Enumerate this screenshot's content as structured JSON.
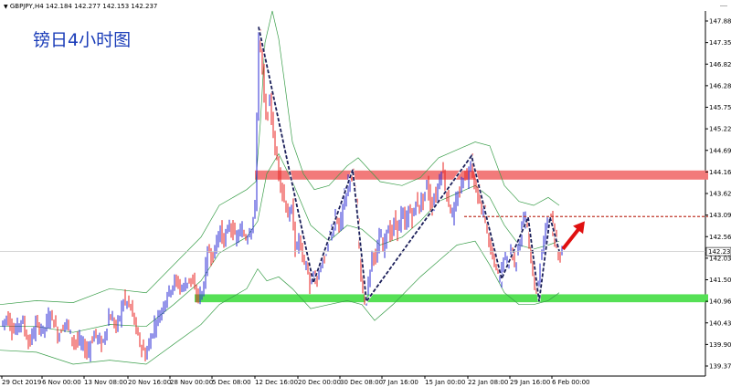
{
  "header": {
    "dropdown_icon": "triangle-down-icon",
    "symbol_timeframe": "GBPJPY,H4",
    "ohlc": "142.184 142.277 142.153 142.237"
  },
  "annotation": {
    "title": "镑日4小时图"
  },
  "colors": {
    "candle_up": "#2b2bd6",
    "candle_down": "#e8211f",
    "bollinger": "#3a9e4a",
    "resistance_zone": "#f27a7a",
    "support_zone": "#55e055",
    "trend_line": "#1b1f5a",
    "arrow": "#e01010",
    "dashed_level": "#c0392b"
  },
  "chart_data": {
    "type": "candlestick",
    "symbol": "GBPJPY",
    "timeframe": "H4",
    "current_price": 142.237,
    "current_price_label": "142.237",
    "ylim": [
      139.1,
      148.3
    ],
    "y_ticks": [
      "147.880",
      "147.350",
      "146.820",
      "146.285",
      "145.755",
      "145.220",
      "144.690",
      "144.160",
      "143.625",
      "143.095",
      "142.560",
      "142.030",
      "141.500",
      "140.965",
      "140.435",
      "139.905",
      "139.370"
    ],
    "x_ticks": [
      "29 Oct 2019",
      "6 Nov 00:00",
      "13 Nov 08:00",
      "20 Nov 16:00",
      "28 Nov 00:00",
      "5 Dec 08:00",
      "12 Dec 16:00",
      "20 Dec 00:00",
      "30 Dec 08:00",
      "7 Jan 16:00",
      "15 Jan 00:00",
      "22 Jan 08:00",
      "29 Jan 16:00",
      "6 Feb 00:00"
    ],
    "price_path": [
      [
        0,
        140.35
      ],
      [
        8,
        140.6
      ],
      [
        16,
        140.2
      ],
      [
        24,
        140.55
      ],
      [
        32,
        139.9
      ],
      [
        40,
        140.4
      ],
      [
        48,
        140.25
      ],
      [
        56,
        140.7
      ],
      [
        64,
        140.1
      ],
      [
        72,
        140.5
      ],
      [
        80,
        140.0
      ],
      [
        88,
        139.95
      ],
      [
        96,
        139.7
      ],
      [
        104,
        140.2
      ],
      [
        112,
        139.85
      ],
      [
        120,
        140.65
      ],
      [
        128,
        140.3
      ],
      [
        136,
        141.05
      ],
      [
        144,
        140.8
      ],
      [
        152,
        140.0
      ],
      [
        160,
        139.6
      ],
      [
        168,
        140.3
      ],
      [
        176,
        140.7
      ],
      [
        184,
        141.2
      ],
      [
        192,
        141.5
      ],
      [
        200,
        141.3
      ],
      [
        208,
        141.6
      ],
      [
        216,
        141.1
      ],
      [
        222,
        141.2
      ],
      [
        228,
        142.3
      ],
      [
        234,
        142.1
      ],
      [
        240,
        142.8
      ],
      [
        246,
        142.5
      ],
      [
        252,
        142.95
      ],
      [
        258,
        142.55
      ],
      [
        264,
        142.75
      ],
      [
        270,
        142.6
      ],
      [
        276,
        142.9
      ],
      [
        280,
        143.4
      ],
      [
        283,
        147.85
      ],
      [
        286,
        147.3
      ],
      [
        289,
        146.2
      ],
      [
        292,
        145.5
      ],
      [
        295,
        146.1
      ],
      [
        298,
        145.6
      ],
      [
        301,
        144.8
      ],
      [
        304,
        144.5
      ],
      [
        308,
        143.9
      ],
      [
        312,
        143.5
      ],
      [
        316,
        143.1
      ],
      [
        320,
        143.3
      ],
      [
        324,
        142.2
      ],
      [
        328,
        142.6
      ],
      [
        332,
        142.0
      ],
      [
        336,
        141.9
      ],
      [
        340,
        141.3
      ],
      [
        344,
        141.6
      ],
      [
        348,
        141.5
      ],
      [
        352,
        142.1
      ],
      [
        356,
        142.0
      ],
      [
        360,
        142.6
      ],
      [
        364,
        142.8
      ],
      [
        368,
        143.2
      ],
      [
        372,
        142.8
      ],
      [
        376,
        143.4
      ],
      [
        380,
        143.7
      ],
      [
        384,
        144.3
      ],
      [
        388,
        143.8
      ],
      [
        392,
        142.9
      ],
      [
        396,
        141.4
      ],
      [
        400,
        141.05
      ],
      [
        404,
        141.5
      ],
      [
        408,
        142.3
      ],
      [
        412,
        142.0
      ],
      [
        416,
        142.7
      ],
      [
        420,
        142.3
      ],
      [
        424,
        142.9
      ],
      [
        428,
        142.6
      ],
      [
        432,
        143.0
      ],
      [
        436,
        142.8
      ],
      [
        440,
        143.2
      ],
      [
        444,
        142.9
      ],
      [
        448,
        143.3
      ],
      [
        452,
        143.1
      ],
      [
        456,
        143.5
      ],
      [
        460,
        143.4
      ],
      [
        464,
        143.6
      ],
      [
        468,
        144.0
      ],
      [
        472,
        143.3
      ],
      [
        476,
        143.6
      ],
      [
        480,
        143.9
      ],
      [
        484,
        144.4
      ],
      [
        488,
        143.8
      ],
      [
        492,
        143.4
      ],
      [
        496,
        143.1
      ],
      [
        500,
        143.5
      ],
      [
        504,
        143.8
      ],
      [
        508,
        144.2
      ],
      [
        512,
        144.1
      ],
      [
        516,
        144.6
      ],
      [
        520,
        144.0
      ],
      [
        524,
        143.6
      ],
      [
        528,
        143.3
      ],
      [
        532,
        143.0
      ],
      [
        536,
        142.4
      ],
      [
        540,
        142.1
      ],
      [
        544,
        141.7
      ],
      [
        548,
        141.6
      ],
      [
        552,
        142.2
      ],
      [
        556,
        141.9
      ],
      [
        560,
        142.4
      ],
      [
        564,
        141.8
      ],
      [
        568,
        142.5
      ],
      [
        572,
        142.9
      ],
      [
        576,
        143.1
      ],
      [
        580,
        142.3
      ],
      [
        584,
        141.6
      ],
      [
        588,
        141.1
      ],
      [
        592,
        142.1
      ],
      [
        596,
        142.5
      ],
      [
        600,
        143.2
      ],
      [
        604,
        142.9
      ],
      [
        608,
        142.5
      ],
      [
        612,
        142.2
      ],
      [
        616,
        142.237
      ]
    ],
    "bollinger_upper": [
      [
        0,
        140.9
      ],
      [
        40,
        141.0
      ],
      [
        80,
        140.95
      ],
      [
        120,
        141.3
      ],
      [
        160,
        141.2
      ],
      [
        190,
        141.9
      ],
      [
        220,
        142.6
      ],
      [
        240,
        143.4
      ],
      [
        270,
        143.8
      ],
      [
        280,
        144.0
      ],
      [
        285,
        145.5
      ],
      [
        290,
        147.5
      ],
      [
        298,
        148.3
      ],
      [
        305,
        147.6
      ],
      [
        312,
        146.4
      ],
      [
        320,
        145.0
      ],
      [
        332,
        144.2
      ],
      [
        344,
        143.8
      ],
      [
        360,
        143.9
      ],
      [
        380,
        144.4
      ],
      [
        392,
        144.6
      ],
      [
        400,
        144.4
      ],
      [
        416,
        144.0
      ],
      [
        440,
        143.9
      ],
      [
        460,
        144.1
      ],
      [
        480,
        144.6
      ],
      [
        500,
        144.8
      ],
      [
        520,
        145.0
      ],
      [
        536,
        144.9
      ],
      [
        552,
        143.9
      ],
      [
        568,
        143.5
      ],
      [
        584,
        143.4
      ],
      [
        600,
        143.6
      ],
      [
        612,
        143.4
      ]
    ],
    "bollinger_middle": [
      [
        0,
        140.35
      ],
      [
        40,
        140.35
      ],
      [
        80,
        140.2
      ],
      [
        120,
        140.4
      ],
      [
        160,
        140.35
      ],
      [
        190,
        140.9
      ],
      [
        220,
        141.5
      ],
      [
        240,
        142.2
      ],
      [
        270,
        142.6
      ],
      [
        282,
        143.0
      ],
      [
        292,
        144.2
      ],
      [
        305,
        144.7
      ],
      [
        320,
        144.0
      ],
      [
        340,
        142.9
      ],
      [
        360,
        142.5
      ],
      [
        380,
        142.9
      ],
      [
        396,
        142.8
      ],
      [
        416,
        142.4
      ],
      [
        440,
        142.6
      ],
      [
        460,
        143.0
      ],
      [
        480,
        143.5
      ],
      [
        500,
        143.7
      ],
      [
        520,
        143.9
      ],
      [
        536,
        143.6
      ],
      [
        552,
        142.9
      ],
      [
        568,
        142.4
      ],
      [
        584,
        142.3
      ],
      [
        600,
        142.4
      ],
      [
        612,
        142.5
      ]
    ],
    "bollinger_lower": [
      [
        0,
        139.75
      ],
      [
        40,
        139.7
      ],
      [
        80,
        139.4
      ],
      [
        120,
        139.5
      ],
      [
        160,
        139.4
      ],
      [
        190,
        139.9
      ],
      [
        220,
        140.4
      ],
      [
        240,
        140.9
      ],
      [
        270,
        141.3
      ],
      [
        282,
        141.8
      ],
      [
        292,
        141.5
      ],
      [
        305,
        141.6
      ],
      [
        320,
        141.3
      ],
      [
        340,
        140.8
      ],
      [
        360,
        140.9
      ],
      [
        380,
        141.0
      ],
      [
        396,
        140.9
      ],
      [
        410,
        140.5
      ],
      [
        430,
        140.9
      ],
      [
        460,
        141.6
      ],
      [
        480,
        142.0
      ],
      [
        500,
        142.4
      ],
      [
        520,
        142.5
      ],
      [
        536,
        141.9
      ],
      [
        552,
        141.2
      ],
      [
        568,
        140.9
      ],
      [
        584,
        140.9
      ],
      [
        600,
        141.0
      ],
      [
        612,
        141.2
      ]
    ],
    "zones": [
      {
        "name": "resistance",
        "from_x": 279,
        "to_x": 775,
        "y_low": 144.05,
        "y_high": 144.28
      },
      {
        "name": "support",
        "from_x": 213,
        "to_x": 775,
        "y_low": 140.96,
        "y_high": 141.16
      }
    ],
    "dashed_level": {
      "from_x": 508,
      "to_x": 775,
      "y": 143.12
    },
    "zigzag": [
      [
        283,
        147.9
      ],
      [
        343,
        141.45
      ],
      [
        386,
        144.3
      ],
      [
        401,
        140.98
      ],
      [
        516,
        144.65
      ],
      [
        549,
        141.55
      ],
      [
        578,
        143.1
      ],
      [
        590,
        140.98
      ],
      [
        602,
        143.1
      ],
      [
        612,
        142.25
      ]
    ],
    "arrow": {
      "from": [
        616,
        142.3
      ],
      "to": [
        640,
        143.0
      ]
    }
  }
}
